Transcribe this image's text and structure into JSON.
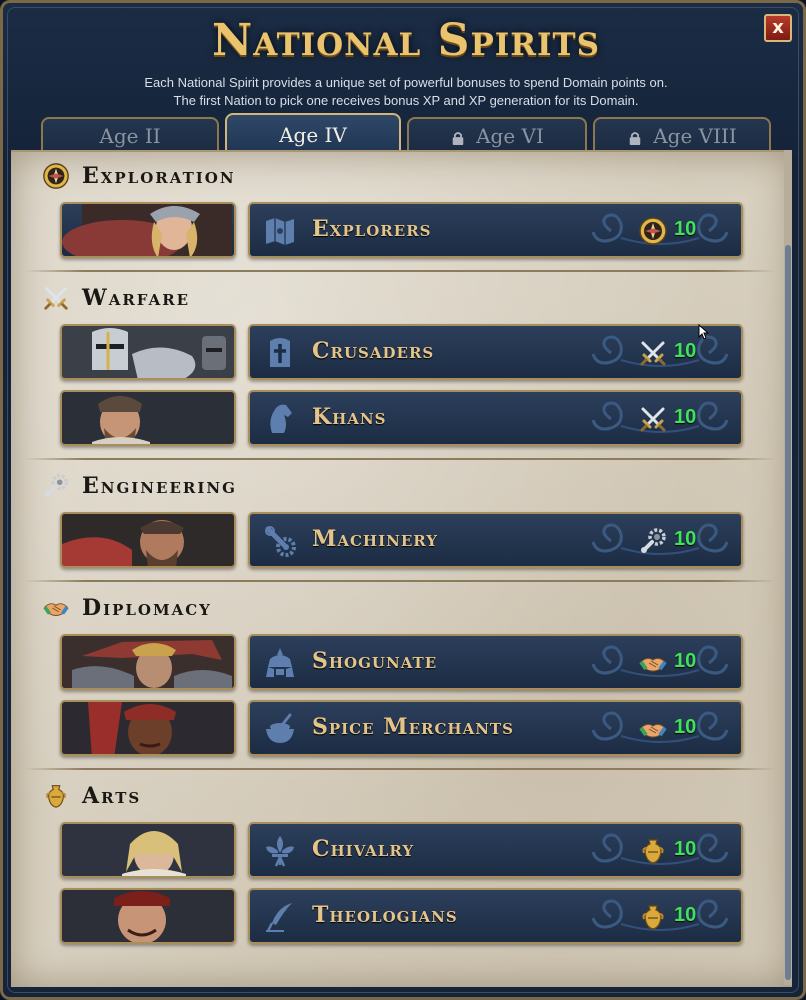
{
  "window": {
    "title": "National Spirits",
    "subtitle_1": "Each National Spirit provides a unique set of powerful bonuses to spend Domain points on.",
    "subtitle_2": "The first Nation to pick one receives bonus XP and XP generation for its Domain.",
    "close_label": "x"
  },
  "tabs": [
    {
      "label": "Age II",
      "locked": false,
      "active": false
    },
    {
      "label": "Age IV",
      "locked": false,
      "active": true
    },
    {
      "label": "Age VI",
      "locked": true,
      "active": false
    },
    {
      "label": "Age VIII",
      "locked": true,
      "active": false
    }
  ],
  "categories": [
    {
      "label": "Exploration",
      "icon": "compass-icon",
      "spirits": [
        {
          "name": "Explorers",
          "icon": "map-icon",
          "cost": "10",
          "cost_icon": "compass-icon"
        }
      ]
    },
    {
      "label": "Warfare",
      "icon": "crossed-swords-icon",
      "spirits": [
        {
          "name": "Crusaders",
          "icon": "templar-helmet-icon",
          "cost": "10",
          "cost_icon": "crossed-swords-icon"
        },
        {
          "name": "Khans",
          "icon": "horse-head-icon",
          "cost": "10",
          "cost_icon": "crossed-swords-icon"
        }
      ]
    },
    {
      "label": "Engineering",
      "icon": "wrench-gear-icon",
      "spirits": [
        {
          "name": "Machinery",
          "icon": "gears-icon",
          "cost": "10",
          "cost_icon": "wrench-gear-icon"
        }
      ]
    },
    {
      "label": "Diplomacy",
      "icon": "handshake-icon",
      "spirits": [
        {
          "name": "Shogunate",
          "icon": "samurai-helmet-icon",
          "cost": "10",
          "cost_icon": "handshake-icon"
        },
        {
          "name": "Spice Merchants",
          "icon": "spice-bowl-icon",
          "cost": "10",
          "cost_icon": "handshake-icon"
        }
      ]
    },
    {
      "label": "Arts",
      "icon": "amphora-icon",
      "spirits": [
        {
          "name": "Chivalry",
          "icon": "fleur-de-lis-icon",
          "cost": "10",
          "cost_icon": "amphora-icon"
        },
        {
          "name": "Theologians",
          "icon": "quill-icon",
          "cost": "10",
          "cost_icon": "amphora-icon"
        }
      ]
    }
  ],
  "colors": {
    "title_gold": "#e9c36d",
    "cost_green": "#3fe25b",
    "spirit_name": "#e4c489",
    "parchment": "#d8d0c0",
    "button_navy": "#2c3f5b",
    "border_gold": "#a78e5b"
  }
}
